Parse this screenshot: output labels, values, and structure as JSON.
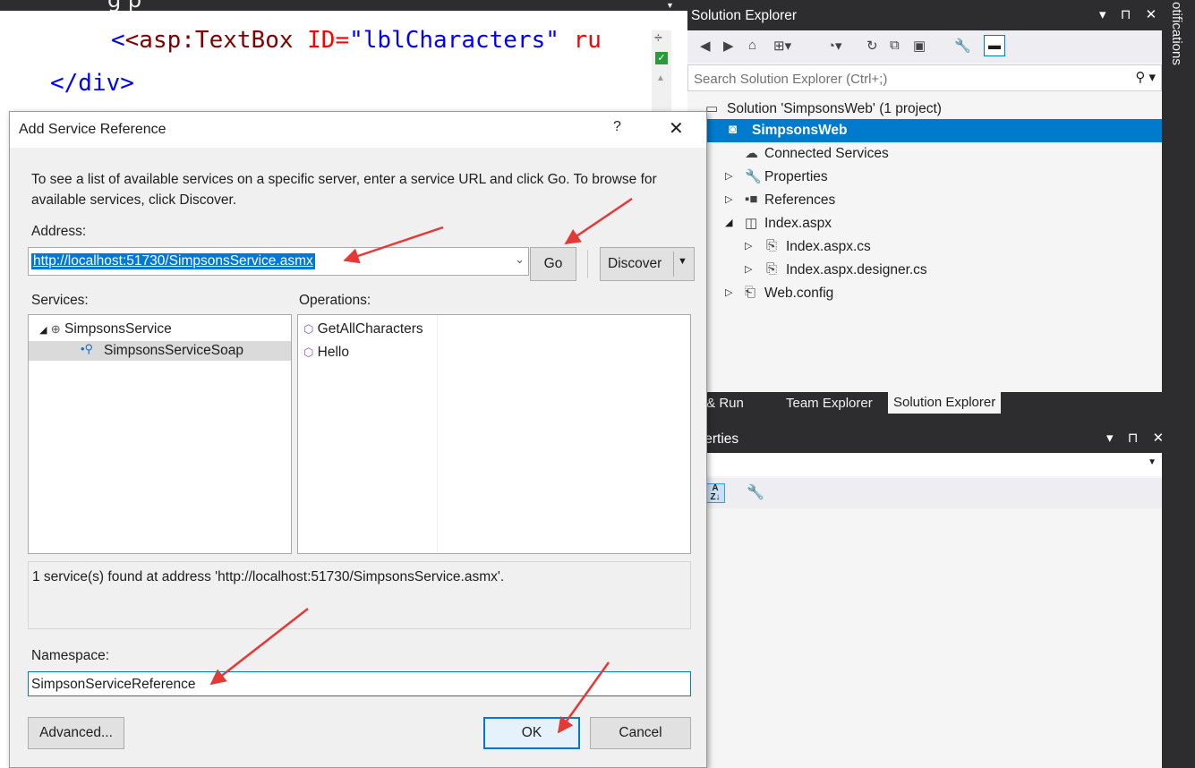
{
  "editor": {
    "heading_partial": "g                    p",
    "line1": {
      "open": "<asp:TextBox",
      "attr": "ID=",
      "value": "\"lblCharacters\"",
      "rest": "ru"
    },
    "line2": "</div>"
  },
  "dialog": {
    "title": "Add Service Reference",
    "help": "?",
    "close": "✕",
    "instructions": "To see a list of available services on a specific server, enter a service URL and click Go. To browse for available services, click Discover.",
    "address_label": "Address:",
    "address_value": "http://localhost:51730/SimpsonsService.asmx",
    "go_label": "Go",
    "discover_label": "Discover",
    "services_label": "Services:",
    "operations_label": "Operations:",
    "services": [
      {
        "label": "SimpsonsService",
        "expanded": true
      },
      {
        "label": "SimpsonsServiceSoap",
        "selected": true
      }
    ],
    "operations": [
      "GetAllCharacters",
      "Hello"
    ],
    "status": "1 service(s) found at address 'http://localhost:51730/SimpsonsService.asmx'.",
    "namespace_label": "Namespace:",
    "namespace_value": "SimpsonServiceReference",
    "advanced_label": "Advanced...",
    "ok_label": "OK",
    "cancel_label": "Cancel"
  },
  "solution_explorer": {
    "title": "Solution Explorer",
    "title_controls": "▾ ⊓ ✕",
    "search_placeholder": "Search Solution Explorer (Ctrl+;)",
    "items": [
      {
        "label": "Solution 'SimpsonsWeb' (1 project)"
      },
      {
        "label": "SimpsonsWeb",
        "selected": true
      },
      {
        "label": "Connected Services"
      },
      {
        "label": "Properties"
      },
      {
        "label": "References"
      },
      {
        "label": "Index.aspx"
      },
      {
        "label": "Index.aspx.cs"
      },
      {
        "label": "Index.aspx.designer.cs"
      },
      {
        "label": "Web.config"
      }
    ]
  },
  "bottom_tabs": [
    "ild & Run",
    "Team Explorer",
    "Solution Explorer"
  ],
  "properties": {
    "title": "operties",
    "title_controls": "▾ ⊓ ✕"
  },
  "notifications_label": "otifications",
  "colors": {
    "selection_blue": "#007acc",
    "dialog_bg": "#f0f0f0",
    "dark_chrome": "#2d2d30",
    "annotation_red": "#e53935"
  }
}
